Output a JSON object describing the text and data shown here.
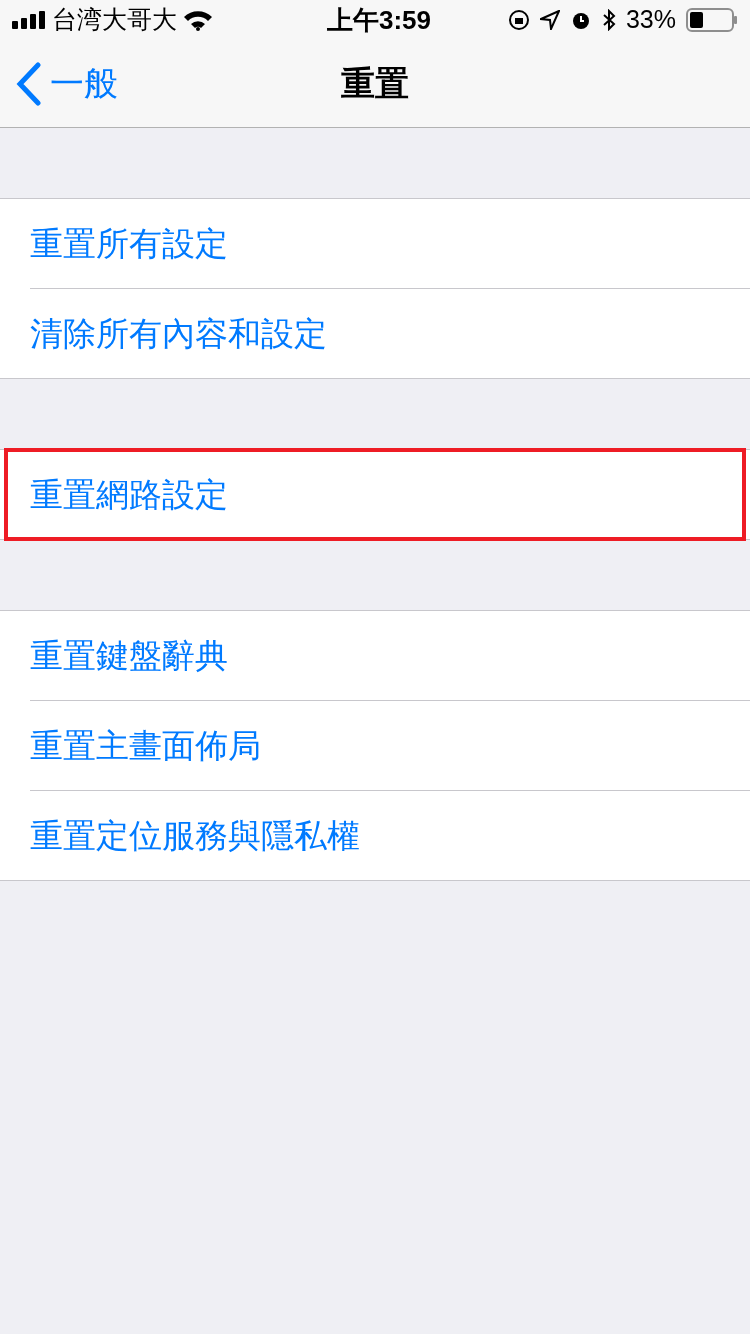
{
  "status_bar": {
    "carrier": "台湾大哥大",
    "time": "上午3:59",
    "battery": "33%"
  },
  "nav_bar": {
    "back": "一般",
    "title": "重置"
  },
  "groups": [
    {
      "items": [
        {
          "label": "重置所有設定",
          "highlighted": false
        },
        {
          "label": "清除所有內容和設定",
          "highlighted": false
        }
      ]
    },
    {
      "items": [
        {
          "label": "重置網路設定",
          "highlighted": true
        }
      ]
    },
    {
      "items": [
        {
          "label": "重置鍵盤辭典",
          "highlighted": false
        },
        {
          "label": "重置主畫面佈局",
          "highlighted": false
        },
        {
          "label": "重置定位服務與隱私權",
          "highlighted": false
        }
      ]
    }
  ]
}
